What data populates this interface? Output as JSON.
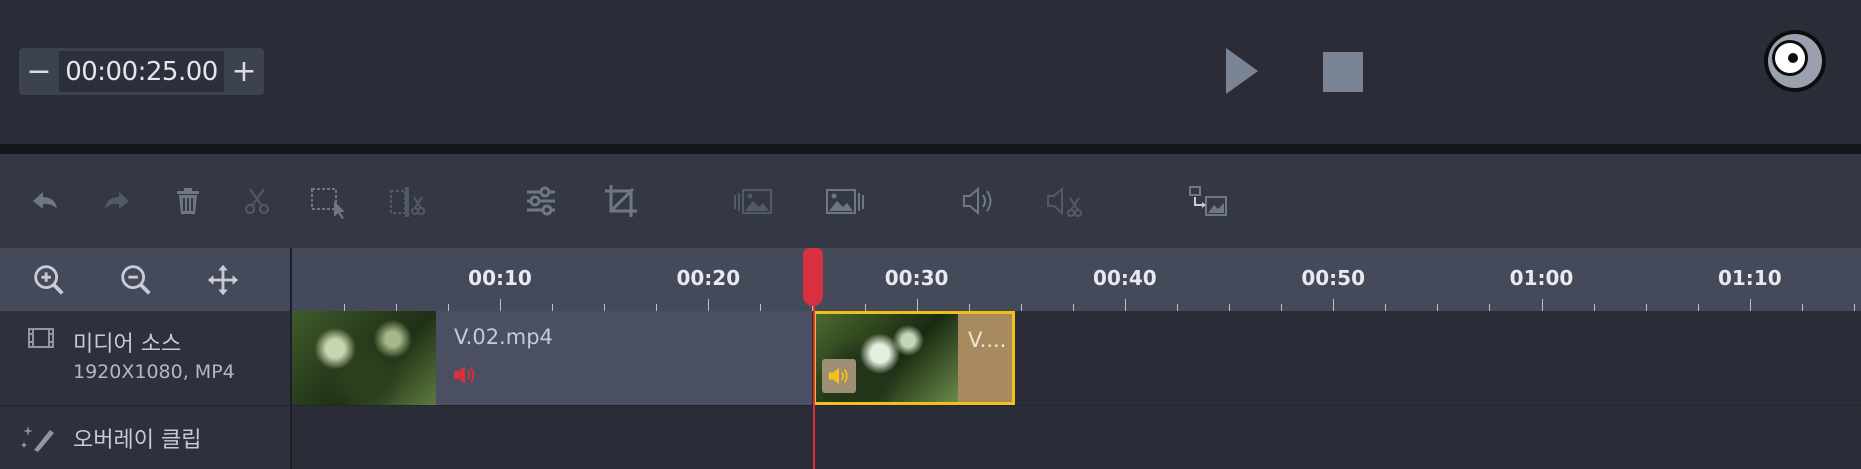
{
  "player": {
    "timecode": "00:00:25.00",
    "decrement_label": "−",
    "increment_label": "+"
  },
  "toolbar": {
    "icons": [
      "undo-icon",
      "redo-icon",
      "trash-icon",
      "cut-icon",
      "select-icon",
      "split-icon",
      "adjust-icon",
      "crop-icon",
      "fade-in-icon",
      "fade-out-icon",
      "volume-icon",
      "mute-icon",
      "replace-icon"
    ]
  },
  "ruler": {
    "ticks": [
      "00:10",
      "00:20",
      "00:30",
      "00:40",
      "00:50",
      "01:00",
      "01:10"
    ]
  },
  "tracks": {
    "media_source": {
      "title": "미디어 소스",
      "meta": "1920X1080, MP4"
    },
    "overlay": {
      "title": "오버레이 클립"
    }
  },
  "clips": [
    {
      "name": "V.02.mp4"
    },
    {
      "name": "V...."
    }
  ],
  "colors": {
    "playhead": "#d83040",
    "selected_border": "#f3c018",
    "audio_red": "#d8303c"
  }
}
